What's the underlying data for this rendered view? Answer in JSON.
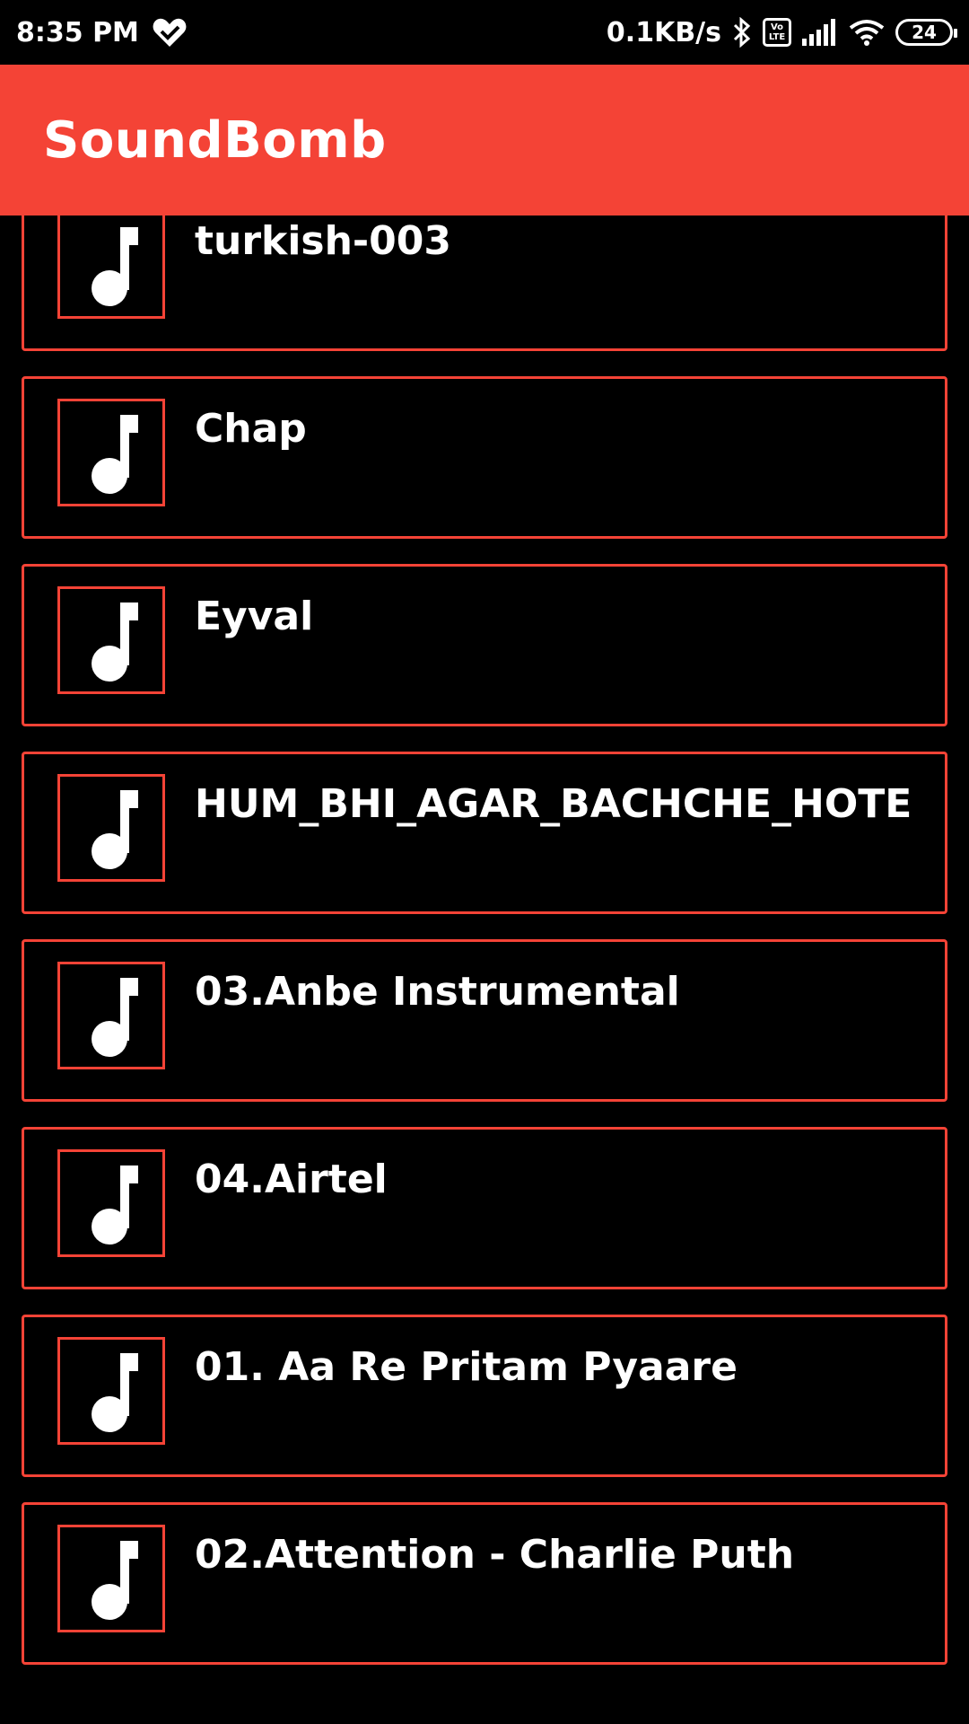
{
  "status_bar": {
    "time": "8:35 PM",
    "net_speed": "0.1KB/s",
    "volte_top": "Vo",
    "volte_bottom": "LTE",
    "battery": "24",
    "icons": [
      "heart-check-icon",
      "bluetooth-icon",
      "volte-icon",
      "signal-icon",
      "wifi-icon",
      "battery-icon"
    ]
  },
  "app_bar": {
    "title": "SoundBomb",
    "color": "#f44336"
  },
  "songs": [
    {
      "title": "turkish-003",
      "icon": "music-note-icon"
    },
    {
      "title": "Chap",
      "icon": "music-note-icon"
    },
    {
      "title": "Eyval",
      "icon": "music-note-icon"
    },
    {
      "title": "HUM_BHI_AGAR_BACHCHE_HOTE",
      "icon": "music-note-icon"
    },
    {
      "title": "03.Anbe Instrumental",
      "icon": "music-note-icon"
    },
    {
      "title": "04.Airtel",
      "icon": "music-note-icon"
    },
    {
      "title": "01. Aa Re Pritam Pyaare",
      "icon": "music-note-icon"
    },
    {
      "title": "02.Attention - Charlie Puth",
      "icon": "music-note-icon"
    }
  ]
}
